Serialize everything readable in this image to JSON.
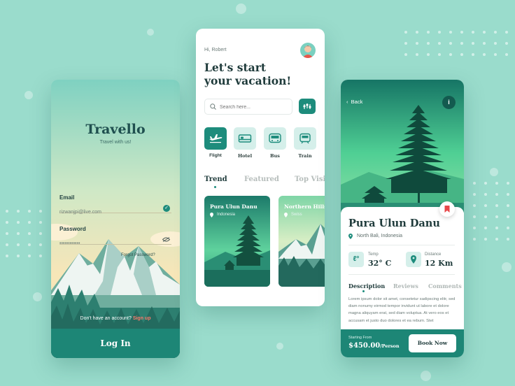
{
  "colors": {
    "background": "#9adccc",
    "primary": "#1d8676",
    "accent": "#ff7a6b",
    "light_teal": "#d5efea"
  },
  "login": {
    "brand": "Travello",
    "tagline": "Travel with us!",
    "email_label": "Email",
    "email_value": "rizwanjpi@live.com",
    "password_label": "Password",
    "password_value": "••••••••••••",
    "forgot": "Forgot Password?",
    "no_account": "Don't have an account?",
    "signup": "Sign up",
    "login_button": "Log In"
  },
  "home": {
    "greeting": "Hi, Robert",
    "headline_line1": "Let's start",
    "headline_line2": "your vacation!",
    "search_placeholder": "Search here...",
    "categories": [
      {
        "label": "Flight",
        "icon": "plane-icon"
      },
      {
        "label": "Hotel",
        "icon": "bed-icon"
      },
      {
        "label": "Bus",
        "icon": "bus-icon"
      },
      {
        "label": "Train",
        "icon": "train-icon"
      }
    ],
    "tabs": [
      "Trend",
      "Featured",
      "Top Visit"
    ],
    "cards": [
      {
        "title": "Pura Ulun Danu",
        "location": "Indonesia"
      },
      {
        "title": "Northern Hills",
        "location": "Swiss"
      }
    ]
  },
  "detail": {
    "back": "Back",
    "info": "i",
    "place": "Pura Ulun Danu",
    "location": "North Bali, Indonesia",
    "temp_label": "Temp",
    "temp_value": "32° C",
    "distance_label": "Distance",
    "distance_value": "12 Km",
    "tabs": [
      "Description",
      "Reviews",
      "Comments"
    ],
    "description": "Lorem ipsum dolor sit amet, consetetur sadipscing elitr, sed diam nonumy eirmod tempor invidunt ut labore et dolore magna aliquyam erat, sed diam voluptua. At vero eos et accusam et justo duo dolores et ea rebum. Stet",
    "starting_from": "Starting From",
    "price": "$450.00",
    "per": "/Person",
    "book_button": "Book Now"
  }
}
